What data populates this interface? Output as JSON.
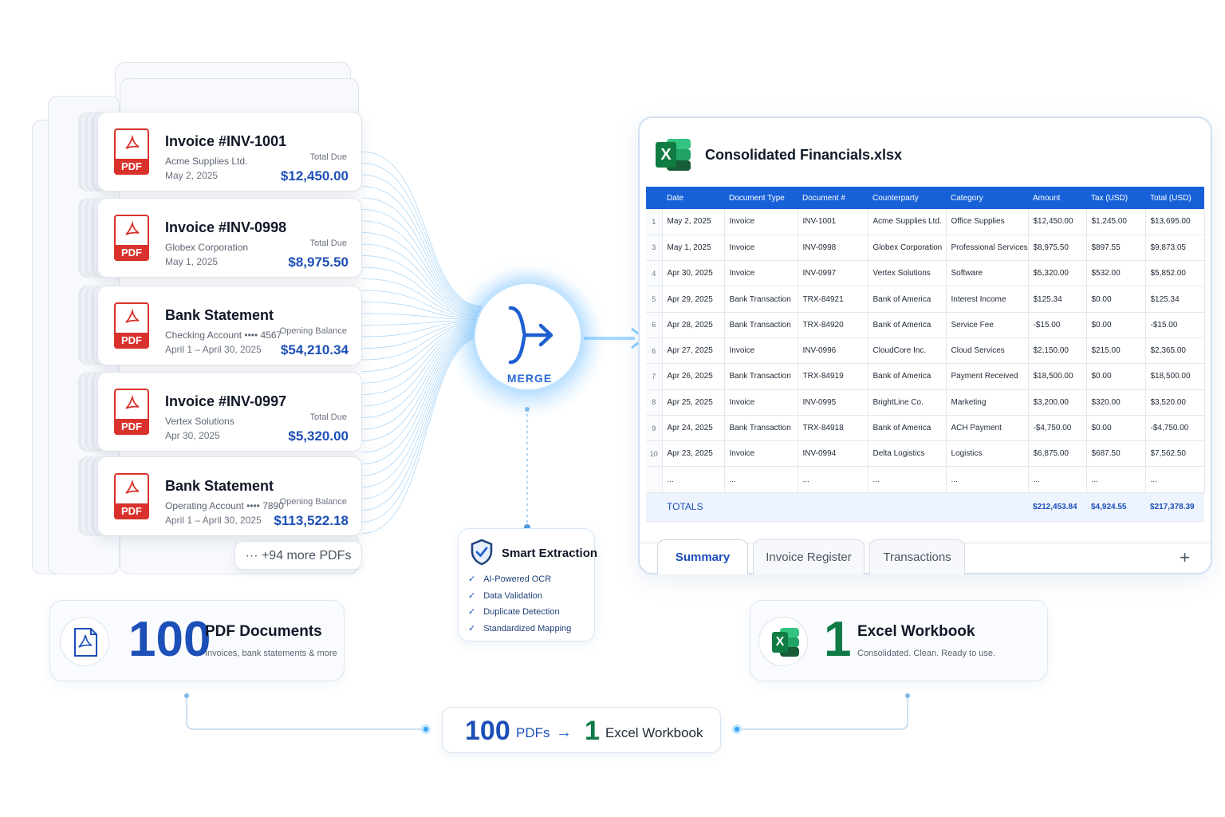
{
  "pdf_documents": [
    {
      "title": "Invoice #INV-1001",
      "party": "Acme Supplies Ltd.",
      "date": "May 2, 2025",
      "amount_label": "Total Due",
      "amount": "$12,450.00"
    },
    {
      "title": "Invoice #INV-0998",
      "party": "Globex Corporation",
      "date": "May 1, 2025",
      "amount_label": "Total Due",
      "amount": "$8,975.50"
    },
    {
      "title": "Bank Statement",
      "party": "Checking Account   •••• 4567",
      "date": "April 1 – April 30, 2025",
      "amount_label": "Opening Balance",
      "amount": "$54,210.34"
    },
    {
      "title": "Invoice #INV-0997",
      "party": "Vertex Solutions",
      "date": "Apr 30, 2025",
      "amount_label": "Total Due",
      "amount": "$5,320.00"
    },
    {
      "title": "Bank Statement",
      "party": "Operating Account   •••• 7890",
      "date": "April 1 – April 30, 2025",
      "amount_label": "Opening Balance",
      "amount": "$113,522.18"
    }
  ],
  "pdf_tag": "PDF",
  "more_pdfs": "··· +94 more PDFs",
  "merge_label": "MERGE",
  "extraction": {
    "title": "Smart Extraction",
    "check_glyph": "✓",
    "items": [
      "AI-Powered OCR",
      "Data Validation",
      "Duplicate Detection",
      "Standardized Mapping"
    ]
  },
  "workbook": {
    "filename": "Consolidated Financials.xlsx",
    "icon_letter": "X",
    "columns": [
      "Date",
      "Document Type",
      "Document #",
      "Counterparty",
      "Category",
      "Amount",
      "Tax (USD)",
      "Total (USD)"
    ],
    "rows": [
      {
        "n": "1",
        "cells": [
          "May 2, 2025",
          "Invoice",
          "INV-1001",
          "Acme Supplies Ltd.",
          "Office Supplies",
          "$12,450.00",
          "$1,245.00",
          "$13,695.00"
        ]
      },
      {
        "n": "3",
        "cells": [
          "May 1, 2025",
          "Invoice",
          "INV-0998",
          "Globex Corporation",
          "Professional Services",
          "$8,975.50",
          "$897.55",
          "$9,873.05"
        ]
      },
      {
        "n": "4",
        "cells": [
          "Apr 30, 2025",
          "Invoice",
          "INV-0997",
          "Vertex Solutions",
          "Software",
          "$5,320.00",
          "$532.00",
          "$5,852.00"
        ]
      },
      {
        "n": "5",
        "cells": [
          "Apr 29, 2025",
          "Bank Transaction",
          "TRX-84921",
          "Bank of America",
          "Interest Income",
          "$125.34",
          "$0.00",
          "$125.34"
        ]
      },
      {
        "n": "6",
        "cells": [
          "Apr 28, 2025",
          "Bank Transaction",
          "TRX-84920",
          "Bank of America",
          "Service Fee",
          "-$15.00",
          "$0.00",
          "-$15.00"
        ]
      },
      {
        "n": "6",
        "cells": [
          "Apr 27, 2025",
          "Invoice",
          "INV-0996",
          "CloudCore Inc.",
          "Cloud Services",
          "$2,150.00",
          "$215.00",
          "$2,365.00"
        ]
      },
      {
        "n": "7",
        "cells": [
          "Apr 26, 2025",
          "Bank Transaction",
          "TRX-84919",
          "Bank of America",
          "Payment Received",
          "$18,500.00",
          "$0.00",
          "$18,500.00"
        ]
      },
      {
        "n": "8",
        "cells": [
          "Apr 25, 2025",
          "Invoice",
          "INV-0995",
          "BrightLine Co.",
          "Marketing",
          "$3,200.00",
          "$320.00",
          "$3,520.00"
        ]
      },
      {
        "n": "9",
        "cells": [
          "Apr 24, 2025",
          "Bank Transaction",
          "TRX-84918",
          "Bank of America",
          "ACH Payment",
          "-$4,750.00",
          "$0.00",
          "-$4,750.00"
        ]
      },
      {
        "n": "10",
        "cells": [
          "Apr 23, 2025",
          "Invoice",
          "INV-0994",
          "Delta Logistics",
          "Logistics",
          "$6,875.00",
          "$687.50",
          "$7,562.50"
        ]
      },
      {
        "n": "",
        "cells": [
          "...",
          "...",
          "...",
          "...",
          "...",
          "...",
          "...",
          "..."
        ]
      }
    ],
    "totals": {
      "label": "TOTALS",
      "amount": "$212,453.84",
      "tax": "$4,924.55",
      "total": "$217,378.39"
    },
    "tabs": [
      "Summary",
      "Invoice Register",
      "Transactions"
    ],
    "add_tab": "+"
  },
  "summary_left": {
    "count": "100",
    "heading": "PDF Documents",
    "sub": "Invoices, bank statements & more"
  },
  "summary_right": {
    "count": "1",
    "heading": "Excel Workbook",
    "sub": "Consolidated. Clean. Ready to use."
  },
  "bottom": {
    "pdf_count": "100",
    "pdf_word": "PDFs",
    "arrow": "→",
    "xl_count": "1",
    "xl_word": "Excel Workbook"
  },
  "colors": {
    "accent": "#1761d8",
    "pdf_red": "#d9322c",
    "excel_green": "#107c41",
    "glow": "#7cc8ff"
  }
}
